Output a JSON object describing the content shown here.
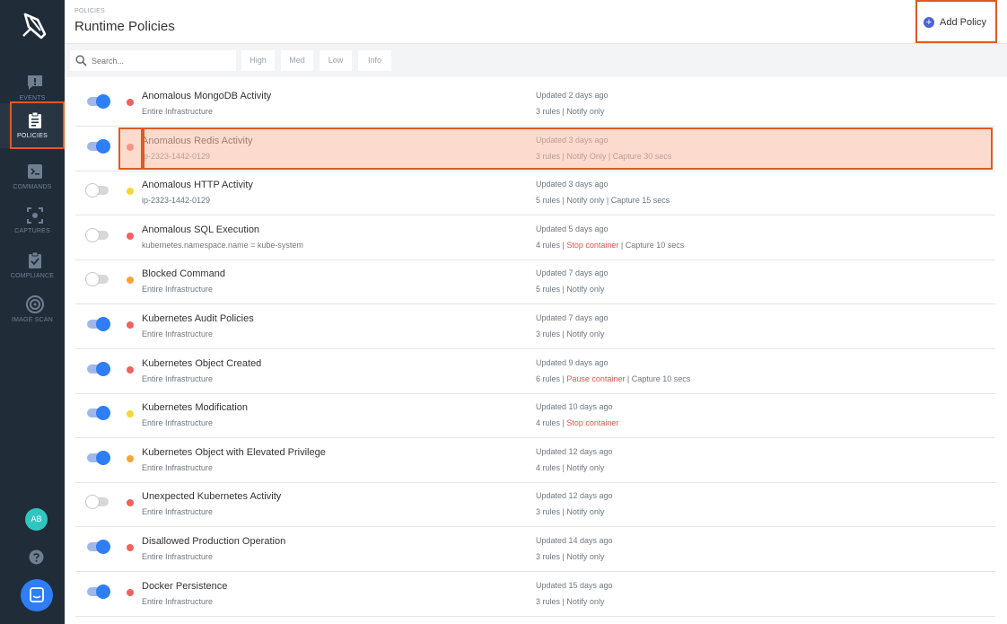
{
  "sidebar": {
    "logo": "app-logo",
    "items": [
      {
        "label": "EVENTS",
        "icon": "events-icon"
      },
      {
        "label": "POLICIES",
        "icon": "policies-icon",
        "active": true
      },
      {
        "label": "COMMANDS",
        "icon": "commands-icon"
      },
      {
        "label": "CAPTURES",
        "icon": "captures-icon"
      },
      {
        "label": "COMPLIANCE",
        "icon": "compliance-icon"
      },
      {
        "label": "IMAGE SCAN",
        "icon": "image-scan-icon"
      }
    ],
    "avatar": "AB",
    "help_icon": "help-icon",
    "chat_icon": "chat-icon"
  },
  "header": {
    "breadcrumb": "POLICIES",
    "title": "Runtime Policies",
    "add_button": "Add Policy"
  },
  "filters": {
    "search_placeholder": "Search...",
    "chips": [
      "High",
      "Med",
      "Low",
      "Info"
    ]
  },
  "colors": {
    "high": "#f0625e",
    "medium": "#f5a53b",
    "low": "#f5d63b",
    "accent": "#2d7ef7",
    "highlight": "#e05a1e"
  },
  "policies": [
    {
      "name": "Anomalous MongoDB Activity",
      "scope": "Entire Infrastructure",
      "updated": "Updated 2 days ago",
      "actions": [
        {
          "text": "3 rules | Notify only"
        }
      ],
      "enabled": true,
      "severity": "high"
    },
    {
      "name": "Anomalous Redis Activity",
      "scope": "ip-2323-1442-0129",
      "updated": "Updated 3 days ago",
      "actions": [
        {
          "text": "3 rules | Notify Only | Capture 30 secs"
        }
      ],
      "enabled": true,
      "severity": "high"
    },
    {
      "name": "Anomalous HTTP Activity",
      "scope": "ip-2323-1442-0129",
      "updated": "Updated 3 days ago",
      "actions": [
        {
          "text": "5 rules | Notify only | Capture 15 secs"
        }
      ],
      "enabled": false,
      "severity": "low"
    },
    {
      "name": "Anomalous SQL Execution",
      "scope": "kubernetes.namespace.name = kube-system",
      "updated": "Updated 5 days ago",
      "actions": [
        {
          "text": "4 rules | "
        },
        {
          "text": "Stop container",
          "warn": true
        },
        {
          "text": " | Capture 10 secs"
        }
      ],
      "enabled": false,
      "severity": "high"
    },
    {
      "name": "Blocked Command",
      "scope": "Entire Infrastructure",
      "updated": "Updated 7 days ago",
      "actions": [
        {
          "text": "5 rules | Notify only"
        }
      ],
      "enabled": false,
      "severity": "medium"
    },
    {
      "name": "Kubernetes Audit Policies",
      "scope": "Entire Infrastructure",
      "updated": "Updated 7 days ago",
      "actions": [
        {
          "text": "3 rules | Notify only"
        }
      ],
      "enabled": true,
      "severity": "high"
    },
    {
      "name": "Kubernetes Object Created",
      "scope": "Entire Infrastructure",
      "updated": "Updated 9 days ago",
      "actions": [
        {
          "text": "6 rules | "
        },
        {
          "text": "Pause container",
          "warn": true
        },
        {
          "text": " | Capture 10 secs"
        }
      ],
      "enabled": true,
      "severity": "high"
    },
    {
      "name": "Kubernetes Modification",
      "scope": "Entire Infrastructure",
      "updated": "Updated 10 days ago",
      "actions": [
        {
          "text": "4 rules | "
        },
        {
          "text": "Stop container",
          "warn": true
        }
      ],
      "enabled": true,
      "severity": "low"
    },
    {
      "name": "Kubernetes Object with Elevated Privilege",
      "scope": "Entire Infrastructure",
      "updated": "Updated 12 days ago",
      "actions": [
        {
          "text": "4 rules | Notify only"
        }
      ],
      "enabled": true,
      "severity": "medium"
    },
    {
      "name": "Unexpected Kubernetes Activity",
      "scope": "Entire Infrastructure",
      "updated": "Updated 12 days ago",
      "actions": [
        {
          "text": "3 rules | Notify only"
        }
      ],
      "enabled": false,
      "severity": "high"
    },
    {
      "name": "Disallowed Production Operation",
      "scope": "Entire Infrastructure",
      "updated": "Updated 14 days ago",
      "actions": [
        {
          "text": "3 rules | Notify only"
        }
      ],
      "enabled": true,
      "severity": "high"
    },
    {
      "name": "Docker Persistence",
      "scope": "Entire Infrastructure",
      "updated": "Updated 15 days ago",
      "actions": [
        {
          "text": "3 rules | Notify only"
        }
      ],
      "enabled": true,
      "severity": "high"
    }
  ]
}
